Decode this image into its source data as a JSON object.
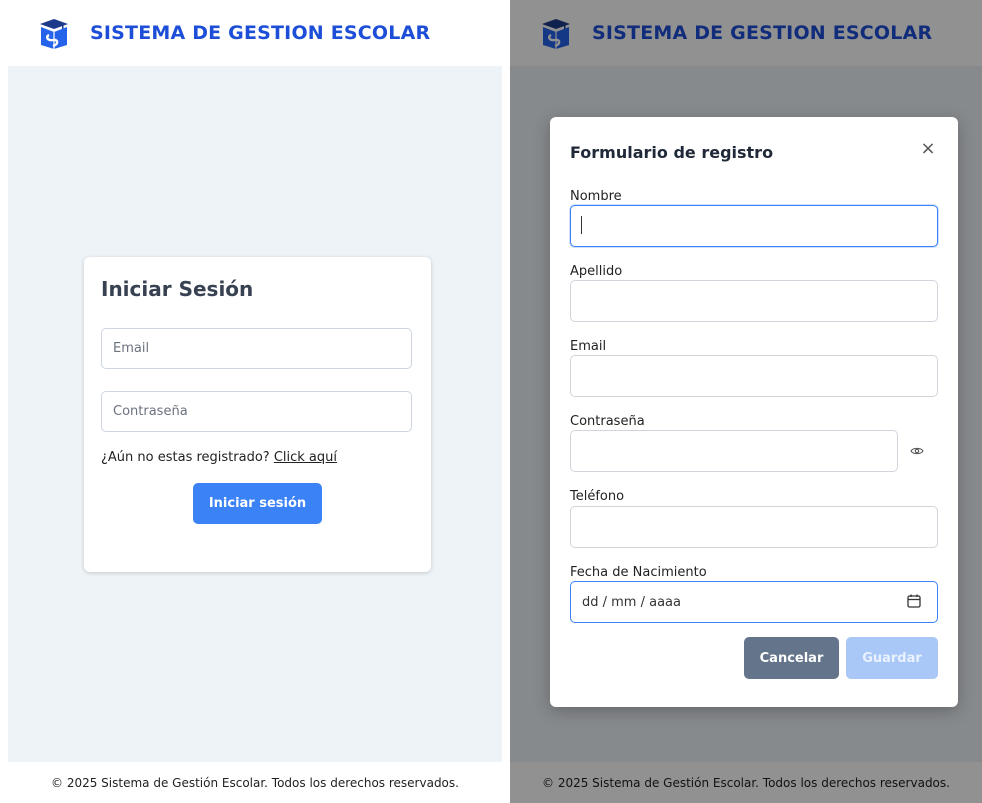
{
  "app": {
    "brand": "SISTEMA DE GESTION ESCOLAR",
    "footer": "© 2025 Sistema de Gestión Escolar. Todos los derechos reservados."
  },
  "login": {
    "title": "Iniciar Sesión",
    "email_placeholder": "Email",
    "password_placeholder": "Contraseña",
    "register_prompt": "¿Aún no estas registrado?",
    "register_link": "Click aquí",
    "submit_label": "Iniciar sesión"
  },
  "register_modal": {
    "title": "Formulario de registro",
    "close_icon": "×",
    "fields": {
      "nombre": "Nombre",
      "apellido": "Apellido",
      "email": "Email",
      "password": "Contraseña",
      "telefono": "Teléfono",
      "fecha": "Fecha de Nacimiento"
    },
    "date_placeholder": "dd / mm / aaaa",
    "cancel_label": "Cancelar",
    "save_label": "Guardar"
  },
  "colors": {
    "brand": "#1d4ed8",
    "primary": "#3b82f6",
    "secondary": "#64748b",
    "disabled": "#a9c8f7"
  },
  "icons": [
    "school-logo-icon",
    "close-icon",
    "eye-icon",
    "calendar-icon"
  ]
}
